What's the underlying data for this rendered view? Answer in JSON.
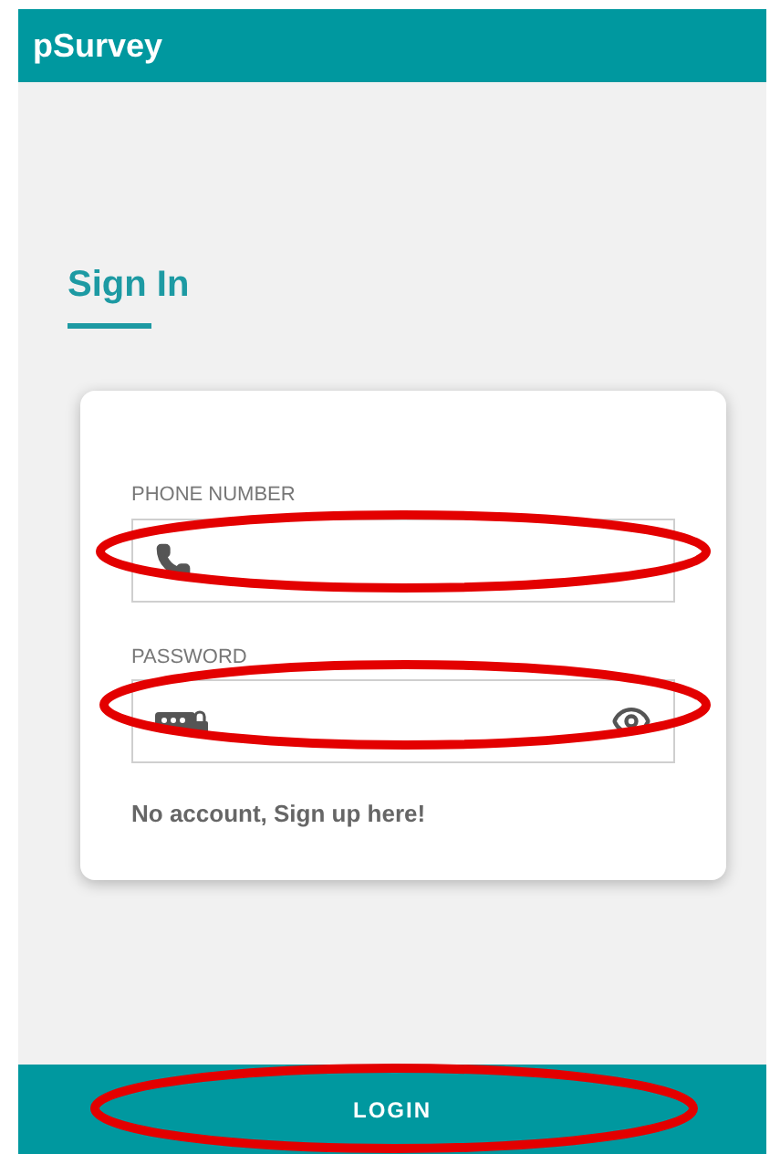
{
  "app_bar": {
    "title": "pSurvey"
  },
  "heading": "Sign In",
  "fields": [
    {
      "label": "PHONE NUMBER",
      "kind": "phone"
    },
    {
      "label": "PASSWORD",
      "kind": "password"
    }
  ],
  "signup_link": "No account, Sign up here!",
  "login_button": "LOGIN"
}
